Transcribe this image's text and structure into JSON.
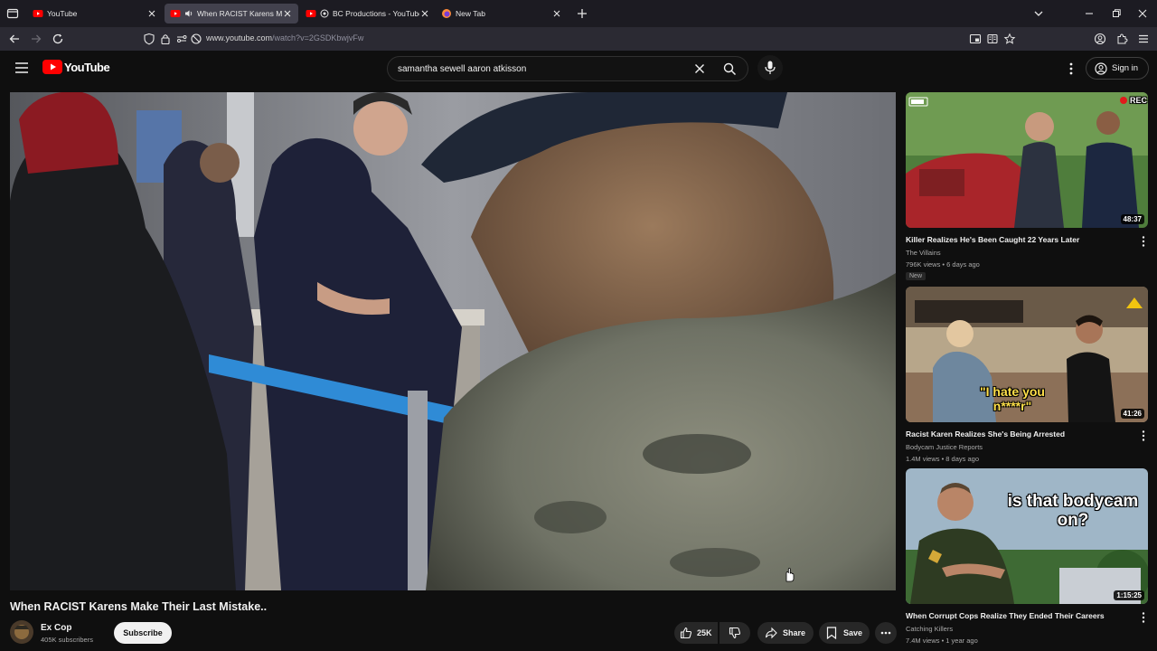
{
  "browser": {
    "tabs": [
      {
        "title": "YouTube",
        "active": false,
        "audio": false
      },
      {
        "title": "When RACIST Karens Make",
        "active": true,
        "audio": true
      },
      {
        "title": "BC Productions - YouTube",
        "active": false,
        "audio": false
      },
      {
        "title": "New Tab",
        "active": false,
        "audio": false
      }
    ],
    "url_host": "www.youtube.com",
    "url_path": "/watch?v=2GSDKbwjvFw"
  },
  "youtube": {
    "logo_text": "YouTube",
    "search_value": "samantha sewell aaron atkisson",
    "signin_label": "Sign in"
  },
  "video": {
    "title": "When RACIST Karens Make Their Last Mistake..",
    "channel": "Ex Cop",
    "subscribers": "405K subscribers",
    "subscribe_label": "Subscribe",
    "likes": "25K",
    "share_label": "Share",
    "save_label": "Save"
  },
  "recommendations": [
    {
      "title": "Killer Realizes He's Been Caught 22 Years Later",
      "channel": "The Villains",
      "meta": "796K views • 6 days ago",
      "badge": "New",
      "duration": "48:37",
      "thumb_text": "REC"
    },
    {
      "title": "Racist Karen Realizes She's Being Arrested",
      "channel": "Bodycam Justice Reports",
      "meta": "1.4M views • 8 days ago",
      "badge": "",
      "duration": "41:26",
      "thumb_text": "\"I hate you n****r\""
    },
    {
      "title": "When Corrupt Cops Realize They Ended Their Careers",
      "channel": "Catching Killers",
      "meta": "7.4M views • 1 year ago",
      "badge": "",
      "duration": "1:15:25",
      "thumb_text": "is that bodycam on?"
    }
  ],
  "colors": {
    "accent": "#ff0000",
    "background": "#0f0f0f",
    "tab_active": "#42414d"
  }
}
